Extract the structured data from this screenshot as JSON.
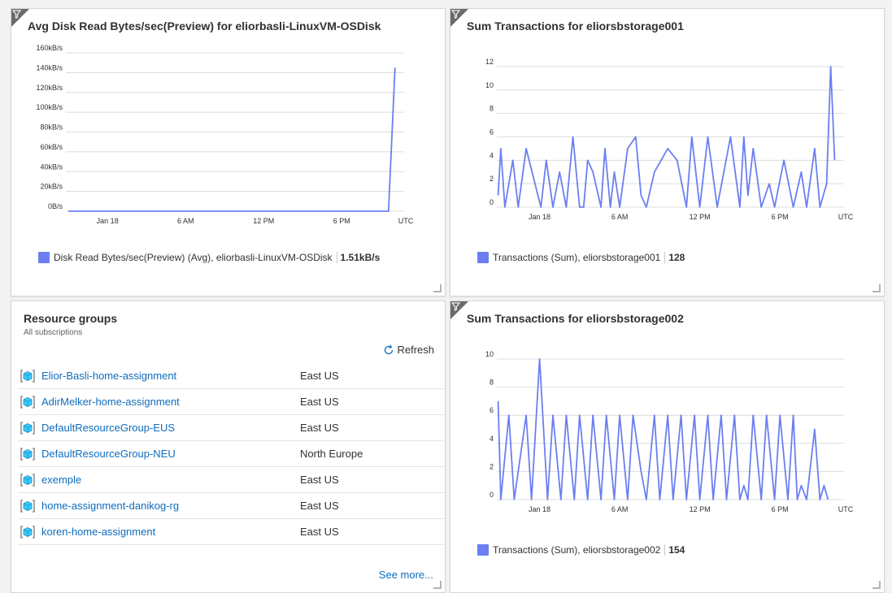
{
  "tiles": {
    "disk_chart": {
      "title": "Avg Disk Read Bytes/sec(Preview) for eliorbasli-LinuxVM-OSDisk",
      "legend_label": "Disk Read Bytes/sec(Preview) (Avg), eliorbasli-LinuxVM-OSDisk",
      "legend_value": "1.51kB/s"
    },
    "tx1_chart": {
      "title": "Sum Transactions for eliorsbstorage001",
      "legend_label": "Transactions (Sum), eliorsbstorage001",
      "legend_value": "128"
    },
    "tx2_chart": {
      "title": "Sum Transactions for eliorsbstorage002",
      "legend_label": "Transactions (Sum), eliorsbstorage002",
      "legend_value": "154"
    },
    "resource_groups": {
      "title": "Resource groups",
      "subtitle": "All subscriptions",
      "refresh_label": "Refresh",
      "see_more_label": "See more...",
      "rows": [
        {
          "name": "Elior-Basli-home-assignment",
          "location": "East US"
        },
        {
          "name": "AdirMelker-home-assignment",
          "location": "East US"
        },
        {
          "name": "DefaultResourceGroup-EUS",
          "location": "East US"
        },
        {
          "name": "DefaultResourceGroup-NEU",
          "location": "North Europe"
        },
        {
          "name": "exemple",
          "location": "East US"
        },
        {
          "name": "home-assignment-danikog-rg",
          "location": "East US"
        },
        {
          "name": "koren-home-assignment",
          "location": "East US"
        }
      ]
    }
  },
  "colors": {
    "series": "#6b7ff1",
    "grid": "#dcdcdc",
    "link": "#0f6cbd"
  },
  "icons": {
    "filter": "filter-icon",
    "refresh": "refresh-icon",
    "resource_group": "resource-group-icon"
  },
  "chart_data": [
    {
      "type": "line",
      "title": "Avg Disk Read Bytes/sec(Preview) for eliorbasli-LinuxVM-OSDisk",
      "x_ticks": [
        "Jan 18",
        "6 AM",
        "12 PM",
        "6 PM",
        "UTC"
      ],
      "y_ticks": [
        "0B/s",
        "20kB/s",
        "40kB/s",
        "60kB/s",
        "80kB/s",
        "100kB/s",
        "120kB/s",
        "140kB/s",
        "160kB/s"
      ],
      "ylim": [
        0,
        160
      ],
      "grid": true,
      "legend_position": "bottom",
      "series": [
        {
          "name": "Disk Read Bytes/sec(Preview) (Avg), eliorbasli-LinuxVM-OSDisk",
          "x": [
            -3,
            21.6,
            22.1
          ],
          "y": [
            0,
            0,
            145
          ]
        }
      ]
    },
    {
      "type": "line",
      "title": "Sum Transactions for eliorsbstorage001",
      "x_ticks": [
        "Jan 18",
        "6 AM",
        "12 PM",
        "6 PM",
        "UTC"
      ],
      "y_ticks": [
        "0",
        "2",
        "4",
        "6",
        "8",
        "10",
        "12"
      ],
      "ylim": [
        0,
        12
      ],
      "grid": true,
      "legend_position": "bottom",
      "series": [
        {
          "name": "Transactions (Sum), eliorsbstorage001",
          "x": [
            -3.1,
            -2.9,
            -2.6,
            -2.0,
            -1.6,
            -1.0,
            0.1,
            0.5,
            1.0,
            1.5,
            2.0,
            2.5,
            3.0,
            3.3,
            3.6,
            4.0,
            4.6,
            4.9,
            5.3,
            5.6,
            6.0,
            6.6,
            7.2,
            7.6,
            8.0,
            8.6,
            9.6,
            10.3,
            11.0,
            11.4,
            12.0,
            12.6,
            13.3,
            14.3,
            15.0,
            15.3,
            15.6,
            16.0,
            16.6,
            17.2,
            17.6,
            18.3,
            19.0,
            19.6,
            20.0,
            20.6,
            21.0,
            21.5,
            21.8,
            22.1
          ],
          "y": [
            1,
            5,
            0,
            4,
            0,
            5,
            0,
            4,
            0,
            3,
            0,
            6,
            0,
            0,
            4,
            3,
            0,
            5,
            0,
            3,
            0,
            5,
            6,
            1,
            0,
            3,
            5,
            4,
            0,
            6,
            0,
            6,
            0,
            6,
            0,
            6,
            1,
            5,
            0,
            2,
            0,
            4,
            0,
            3,
            0,
            5,
            0,
            2,
            12,
            4
          ]
        }
      ]
    },
    {
      "type": "line",
      "title": "Sum Transactions for eliorsbstorage002",
      "x_ticks": [
        "Jan 18",
        "6 AM",
        "12 PM",
        "6 PM",
        "UTC"
      ],
      "y_ticks": [
        "0",
        "2",
        "4",
        "6",
        "8",
        "10"
      ],
      "ylim": [
        0,
        10
      ],
      "grid": true,
      "legend_position": "bottom",
      "series": [
        {
          "name": "Transactions (Sum), eliorsbstorage002",
          "x": [
            -3.1,
            -2.9,
            -2.3,
            -1.9,
            -1.0,
            -0.6,
            0.0,
            0.6,
            1.0,
            1.6,
            2.0,
            2.6,
            3.0,
            3.6,
            4.0,
            4.6,
            5.0,
            5.6,
            6.0,
            6.6,
            7.0,
            7.6,
            8.0,
            8.6,
            9.0,
            9.6,
            10.0,
            10.6,
            11.0,
            11.6,
            12.0,
            12.6,
            13.0,
            13.6,
            14.0,
            14.6,
            15.0,
            15.3,
            15.6,
            16.0,
            16.6,
            17.0,
            17.6,
            18.0,
            18.6,
            19.0,
            19.3,
            19.6,
            20.0,
            20.6,
            21.0,
            21.3,
            21.6
          ],
          "y": [
            7,
            0,
            6,
            0,
            6,
            0,
            10,
            0,
            6,
            0,
            6,
            0,
            6,
            0,
            6,
            0,
            6,
            0,
            6,
            0,
            6,
            2,
            0,
            6,
            0,
            6,
            0,
            6,
            0,
            6,
            0,
            6,
            0,
            6,
            0,
            6,
            0,
            1,
            0,
            6,
            0,
            6,
            0,
            6,
            0,
            6,
            0,
            1,
            0,
            5,
            0,
            1,
            0
          ]
        }
      ]
    }
  ]
}
